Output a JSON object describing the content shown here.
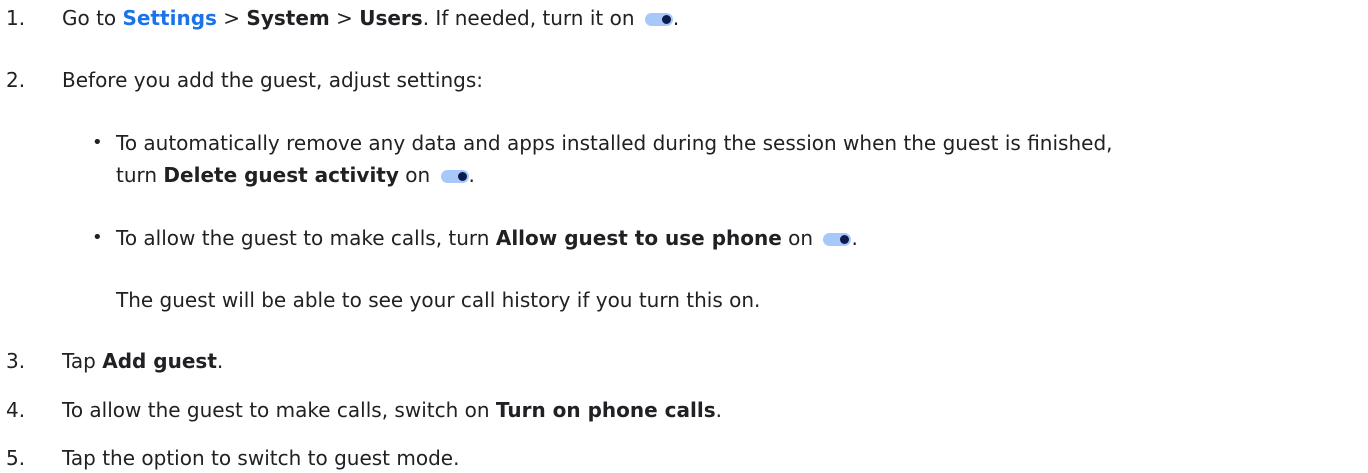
{
  "steps": {
    "s1": {
      "num": "1.",
      "t1": "Go to ",
      "link": "Settings",
      "t2": " > ",
      "b1": "System",
      "t3": " > ",
      "b2": "Users",
      "t4": ". If needed, turn it on ",
      "end": "."
    },
    "s2": {
      "num": "2.",
      "text": "Before you add the guest, adjust settings:"
    },
    "b1": {
      "bullet": "•",
      "line1": "To automatically remove any data and apps installed during the session when the guest is finished,",
      "t1": "turn ",
      "bold": "Delete guest activity",
      "t2": " on ",
      "end": "."
    },
    "b2": {
      "bullet": "•",
      "t1": "To allow the guest to make calls, turn ",
      "bold": "Allow guest to use phone",
      "t2": " on ",
      "end": ".",
      "note": "The guest will be able to see your call history if you turn this on."
    },
    "s3": {
      "num": "3.",
      "t1": "Tap ",
      "bold": "Add guest",
      "end": "."
    },
    "s4": {
      "num": "4.",
      "t1": "To allow the guest to make calls, switch on ",
      "bold": "Turn on phone calls",
      "end": "."
    },
    "s5": {
      "num": "5.",
      "text": "Tap the option to switch to guest mode."
    }
  },
  "icons": {
    "toggle": "toggle-on-icon"
  },
  "colors": {
    "link": "#1a73e8",
    "toggle_track": "#a8c7fa",
    "toggle_thumb": "#0b1c4d"
  }
}
